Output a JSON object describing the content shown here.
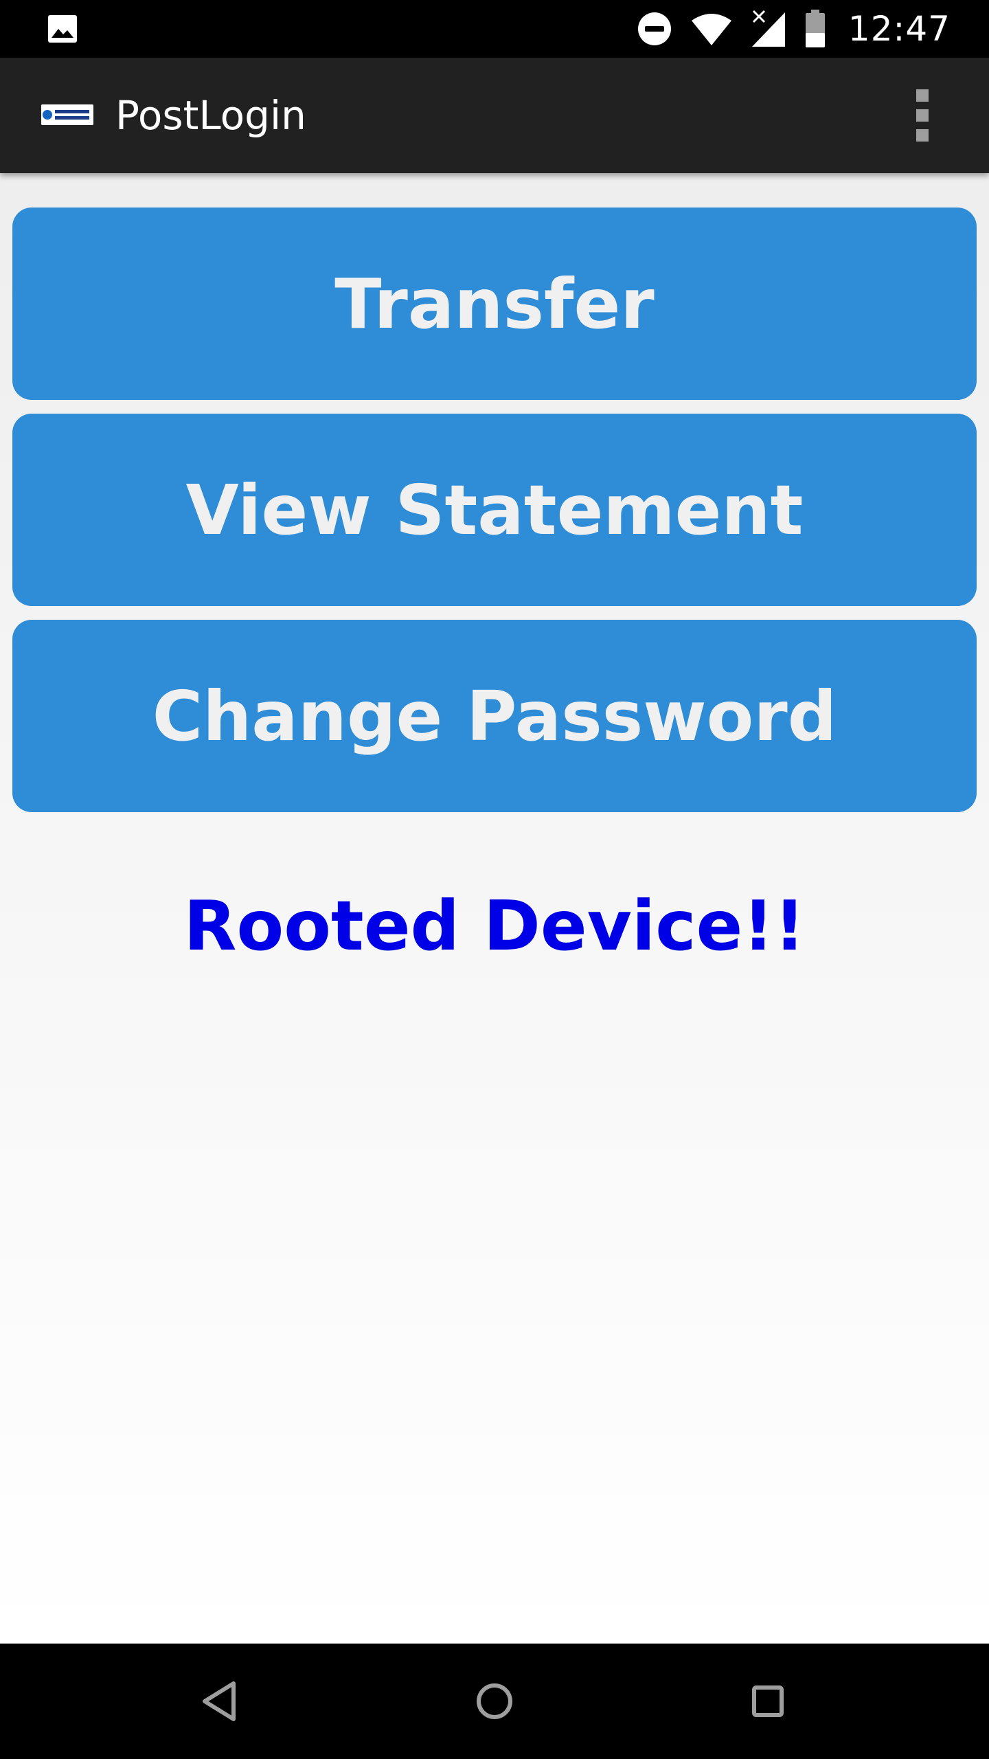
{
  "status_bar": {
    "time": "12:47",
    "icons": [
      "image-notification-icon",
      "do-not-disturb-icon",
      "wifi-icon",
      "cell-signal-no-data-icon",
      "battery-icon"
    ]
  },
  "app_bar": {
    "logo_icon": "security-innovation-logo",
    "title": "PostLogin",
    "menu_icon": "overflow-menu-icon"
  },
  "buttons": {
    "transfer": "Transfer",
    "view_statement": "View Statement",
    "change_password": "Change Password"
  },
  "status_message": "Rooted Device!!",
  "colors": {
    "button_background": "#2f8dd8",
    "button_text": "#f0f0f0",
    "status_message": "#0000e6",
    "app_bar": "#212121"
  },
  "navigation": {
    "icons": [
      "back-icon",
      "home-icon",
      "recents-icon"
    ]
  }
}
